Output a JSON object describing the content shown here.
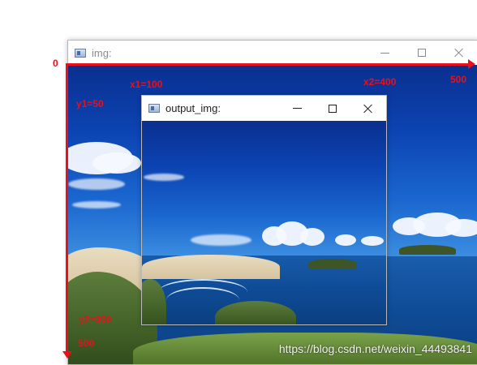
{
  "windows": {
    "main": {
      "title": "img:"
    },
    "output": {
      "title": "output_img:"
    }
  },
  "window_controls": {
    "minimize_icon": "minimize-icon",
    "maximize_icon": "maximize-icon",
    "close_icon": "close-icon"
  },
  "annotations": {
    "origin": "0",
    "x1": "x1=100",
    "x2": "x2=400",
    "x_max": "500",
    "y1": "y1=50",
    "y2": "y2=300",
    "y_max": "500"
  },
  "colors": {
    "annotation": "#e8101c",
    "sky": "#0c44b3",
    "sea": "#1a5fae"
  },
  "watermark": "https://blog.csdn.net/weixin_44493841"
}
